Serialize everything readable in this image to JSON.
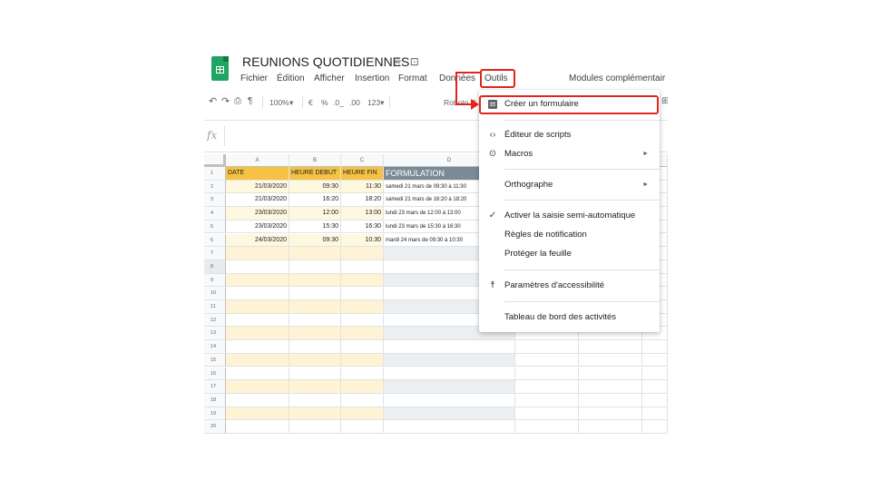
{
  "header": {
    "doc_title": "REUNIONS QUOTIDIENNES",
    "star_icon": "star-icon",
    "folder_icon": "folder-icon"
  },
  "menubar": {
    "items": [
      "Fichier",
      "Édition",
      "Afficher",
      "Insertion",
      "Format",
      "Données",
      "Outils",
      "Modules complémentair"
    ]
  },
  "toolbar": {
    "zoom": "100%",
    "currency": "€",
    "percent": "%",
    "dec_less": ".0_",
    "dec_more": ".00",
    "format_more": "123▾",
    "font": "Roboto C"
  },
  "formula_bar": {
    "label": "fx"
  },
  "grid": {
    "columns": [
      "A",
      "B",
      "C",
      "D"
    ],
    "row_numbers": [
      "1",
      "2",
      "3",
      "4",
      "5",
      "6",
      "7",
      "8",
      "9",
      "10",
      "11",
      "12",
      "13",
      "14",
      "15",
      "16",
      "17",
      "18",
      "19",
      "20"
    ],
    "header_row": [
      "DATE",
      "HEURE DEBUT",
      "HEURE FIN",
      "FORMULATION"
    ],
    "rows": [
      [
        "21/03/2020",
        "09:30",
        "11:30",
        "samedi 21 mars de 09:30 à 11:30"
      ],
      [
        "21/03/2020",
        "16:20",
        "18:20",
        "samedi 21 mars de 16:20 à 18:20"
      ],
      [
        "23/03/2020",
        "12:00",
        "13:00",
        "lundi 23 mars de 12:00 à 13:00"
      ],
      [
        "23/03/2020",
        "15:30",
        "16:30",
        "lundi 23 mars de 15:30 à 16:30"
      ],
      [
        "24/03/2020",
        "09:30",
        "10:30",
        "mardi 24 mars de 09:30 à 10:30"
      ]
    ]
  },
  "dropdown": {
    "items": [
      {
        "label": "Créer un formulaire",
        "icon": "form-icon"
      },
      {
        "label": "Éditeur de scripts",
        "icon": "code-icon"
      },
      {
        "label": "Macros",
        "icon": "play-circle-icon",
        "submenu": true
      },
      {
        "label": "Orthographe",
        "submenu": true
      },
      {
        "label": "Activer la saisie semi-automatique",
        "icon": "check-icon"
      },
      {
        "label": "Règles de notification"
      },
      {
        "label": "Protéger la feuille"
      },
      {
        "label": "Paramètres d'accessibilité",
        "icon": "accessibility-icon"
      },
      {
        "label": "Tableau de bord des activités"
      }
    ]
  },
  "colors": {
    "annotation_red": "#e1251b",
    "header_yellow": "#f6c243",
    "header_gray": "#7a8b97",
    "sheets_green": "#1fa463"
  }
}
